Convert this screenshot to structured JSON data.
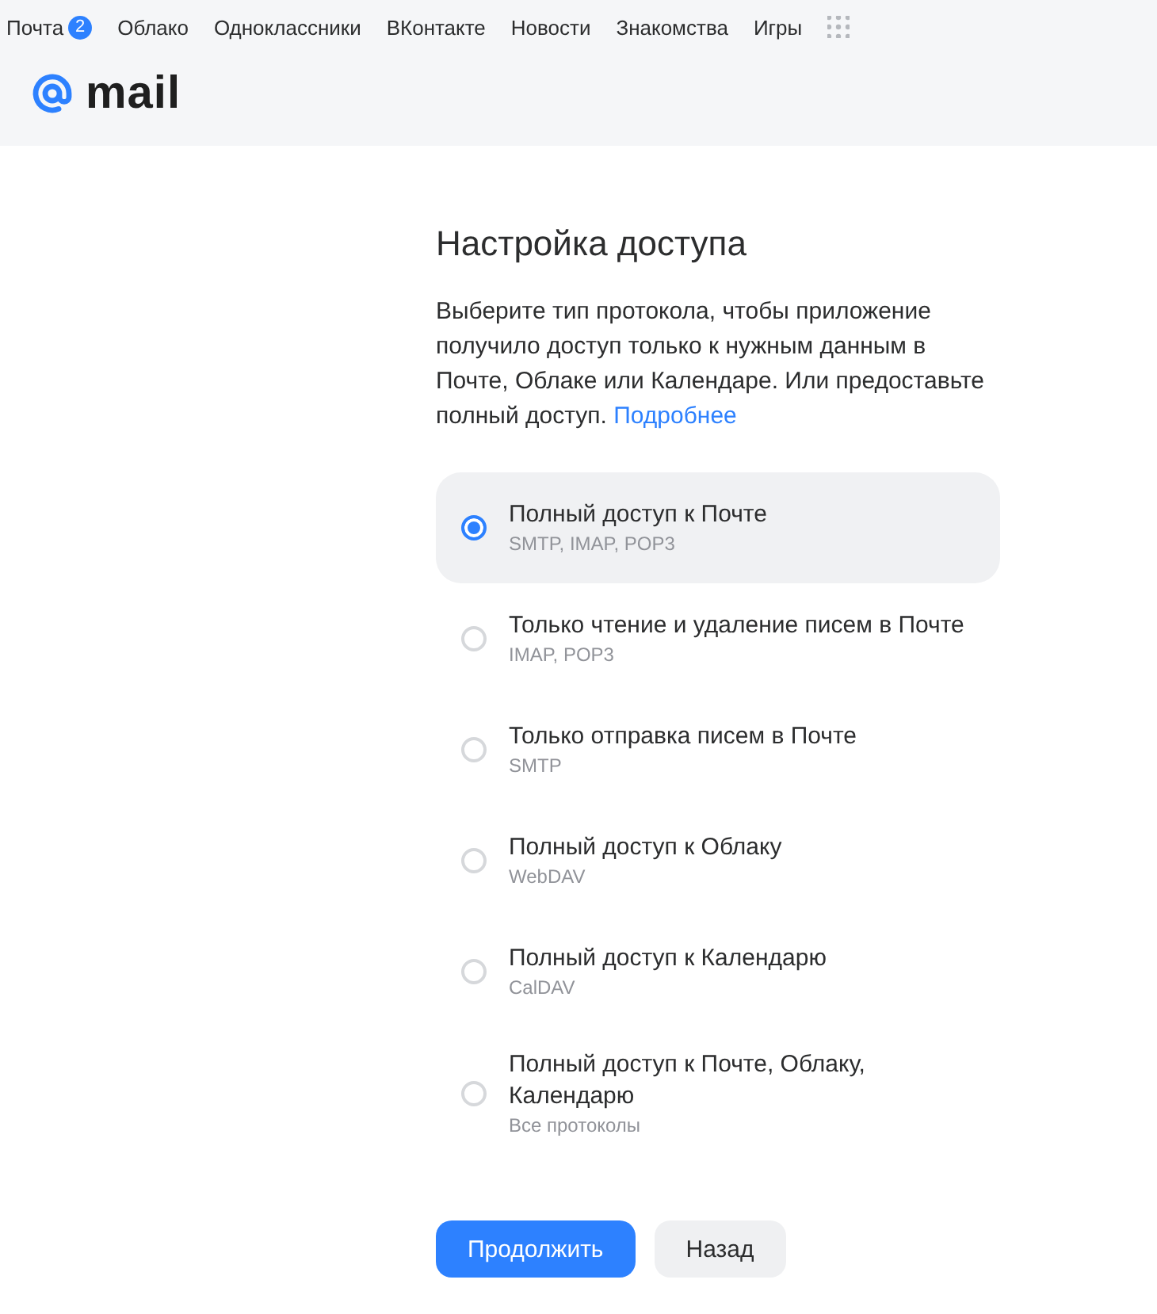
{
  "top_nav": {
    "items": [
      {
        "label": "Почта",
        "badge": "2"
      },
      {
        "label": "Облако"
      },
      {
        "label": "Одноклассники"
      },
      {
        "label": "ВКонтакте"
      },
      {
        "label": "Новости"
      },
      {
        "label": "Знакомства"
      },
      {
        "label": "Игры"
      }
    ]
  },
  "logo": {
    "text": "mail"
  },
  "title": "Настройка доступа",
  "description": "Выберите тип протокола, чтобы приложение получило доступ только к нужным данным в Почте, Облаке или Календаре. Или предоставьте полный доступ.",
  "more_link": "Подробнее",
  "options": [
    {
      "label": "Полный доступ к Почте",
      "protocols": "SMTP, IMAP, POP3",
      "selected": true
    },
    {
      "label": "Только чтение и удаление писем в Почте",
      "protocols": "IMAP, POP3",
      "selected": false
    },
    {
      "label": "Только отправка писем в Почте",
      "protocols": "SMTP",
      "selected": false
    },
    {
      "label": "Полный доступ к Облаку",
      "protocols": "WebDAV",
      "selected": false
    },
    {
      "label": "Полный доступ к Календарю",
      "protocols": "CalDAV",
      "selected": false
    },
    {
      "label": "Полный доступ к Почте, Облаку, Календарю",
      "protocols": "Все протоколы",
      "selected": false
    }
  ],
  "buttons": [
    {
      "label": "Продолжить",
      "kind": "primary"
    },
    {
      "label": "Назад",
      "kind": "secondary"
    }
  ]
}
